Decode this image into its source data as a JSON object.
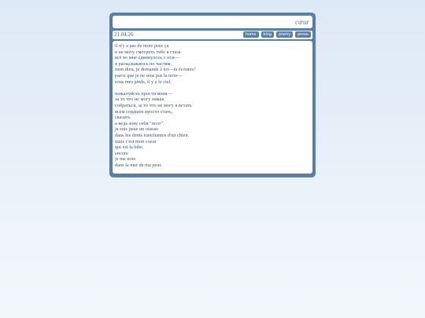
{
  "site": {
    "title": "cœur"
  },
  "entry": {
    "date": "21.04.26"
  },
  "nav": {
    "items": [
      {
        "label": "home"
      },
      {
        "label": "blog"
      },
      {
        "label": "poetry"
      },
      {
        "label": "prose"
      }
    ]
  },
  "poem": {
    "stanza1": [
      "il n'y a pas de mots pour ça",
      "я не могу смотреть тебе в глаза",
      "всё во мне сдвинулось с оси—",
      "я раскалываюсь по частям,",
      "mon dieu, je demande à toi—tu écoutes?",
      "parce que je ne sens pas la terre—",
      "sous mes pieds, il y a le ciel."
    ],
    "stanza2": [
      "пожалуйста прости меня—",
      "за то что не могу никак",
      "собраться, за то что не могу я встать",
      "всем сердцем просто стать,",
      "сказать.",
      "а ведь зову себя \"поэт\".",
      "je suis juste un oiseau",
      "dans les dents tranchantes d'un chien.",
      "mais c'est mon coeur",
      "qui est la bête.",
      "encore",
      "je me noie",
      "dans la mer de ma peur."
    ]
  }
}
